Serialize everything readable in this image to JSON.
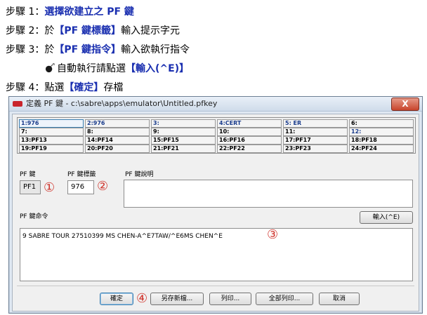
{
  "steps": [
    {
      "prefix": "步驟 1：",
      "highlight": "選擇欲建立之 PF 鍵",
      "suffix": ""
    },
    {
      "prefix": "步驟 2：於",
      "highlight": "【PF 鍵標籤】",
      "suffix": "輸入提示字元"
    },
    {
      "prefix": "步驟 3：於",
      "highlight": "【PF 鍵指令】",
      "suffix": "輸入欲執行指令"
    },
    {
      "prefix": "自動執行請點選",
      "highlight": "【輸入(^E)】",
      "suffix": ""
    },
    {
      "prefix": "步驟 4：點選",
      "highlight": "【確定】",
      "suffix": "存檔"
    }
  ],
  "window": {
    "title": "定義 PF 鍵 - c:\\sabre\\apps\\emulator\\Untitled.pfkey",
    "close_label": "X"
  },
  "keys": [
    [
      "1:976",
      "2:976",
      "3:",
      "4:CERT",
      "5: ER",
      "6:"
    ],
    [
      "7:",
      "8:",
      "9:",
      "10:",
      "11:",
      "12:"
    ],
    [
      "13:PF13",
      "14:PF14",
      "15:PF15",
      "16:PF16",
      "17:PF17",
      "18:PF18"
    ],
    [
      "19:PF19",
      "20:PF20",
      "21:PF21",
      "22:PF22",
      "23:PF23",
      "24:PF24"
    ]
  ],
  "form": {
    "pf_key_label": "PF 鍵",
    "pf_key_value": "PF1",
    "tag_label": "PF 鍵標籤",
    "tag_value": "976",
    "desc_label": "PF 鍵說明",
    "desc_value": "",
    "command_label": "PF 鍵命令",
    "command_value": "9 SABRE TOUR 27510399 MS CHEN-A^E7TAW/^E6MS CHEN^E",
    "enter_button": "輸入(^E)"
  },
  "markers": {
    "m1": "①",
    "m2": "②",
    "m3": "③",
    "m4": "④"
  },
  "buttons": {
    "ok": "確定",
    "save_as": "另存新檔...",
    "print": "列印...",
    "print_all": "全部列印...",
    "cancel": "取消"
  },
  "colors": {
    "highlight": "#1a2fb0",
    "marker": "#d0352d",
    "close": "#c8452c"
  }
}
